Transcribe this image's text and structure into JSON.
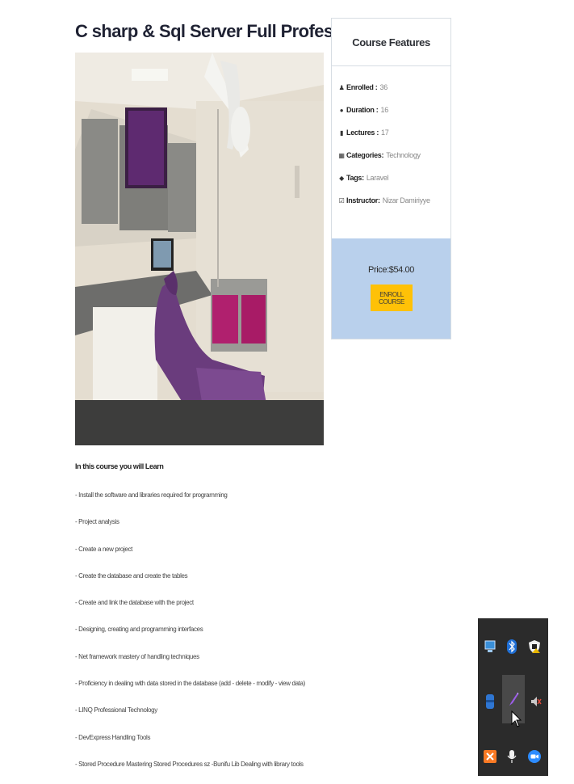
{
  "course": {
    "title": "C sharp & Sql Server Full Professional Course"
  },
  "features": {
    "heading": "Course Features",
    "items": [
      {
        "icon": "user-icon",
        "label": "Enrolled :",
        "value": "36"
      },
      {
        "icon": "clock-icon",
        "label": "Duration :",
        "value": "16"
      },
      {
        "icon": "file-icon",
        "label": "Lectures :",
        "value": "17"
      },
      {
        "icon": "book-icon",
        "label": "Categories:",
        "value": "Technology"
      },
      {
        "icon": "tag-icon",
        "label": "Tags:",
        "value": "Laravel"
      },
      {
        "icon": "check-square-icon",
        "label": "Instructor:",
        "value": "Nizar Damiriyye"
      }
    ],
    "price": "Price:$54.00",
    "enroll_label": "ENROLL COURSE"
  },
  "learn": {
    "heading": "In this course you will Learn",
    "items": [
      "- Install the software and libraries required for programming",
      "- Project analysis",
      "- Create a new project",
      "- Create the database and create the tables",
      "- Create and link the database with the project",
      "- Designing, creating and programming interfaces",
      "- Net framework mastery of handling techniques",
      "- Proficiency in dealing with data stored in the database (add - delete - modify - view data)",
      "- LINQ Professional Technology",
      "- DevExpress Handling Tools",
      "- Stored Procedure Mastering Stored Procedures sz -Bunifu Lib Dealing with library tools"
    ]
  },
  "tray": {
    "icons": [
      "network-monitor-icon",
      "bluetooth-icon",
      "security-shield-icon",
      "app-blue-icon",
      "pen-icon",
      "volume-muted-icon",
      "xampp-icon",
      "microphone-icon",
      "zoom-icon"
    ]
  },
  "colors": {
    "price_panel": "#b9d0ec",
    "enroll_button": "#ffc107",
    "tray_background": "#2b2b2b"
  }
}
